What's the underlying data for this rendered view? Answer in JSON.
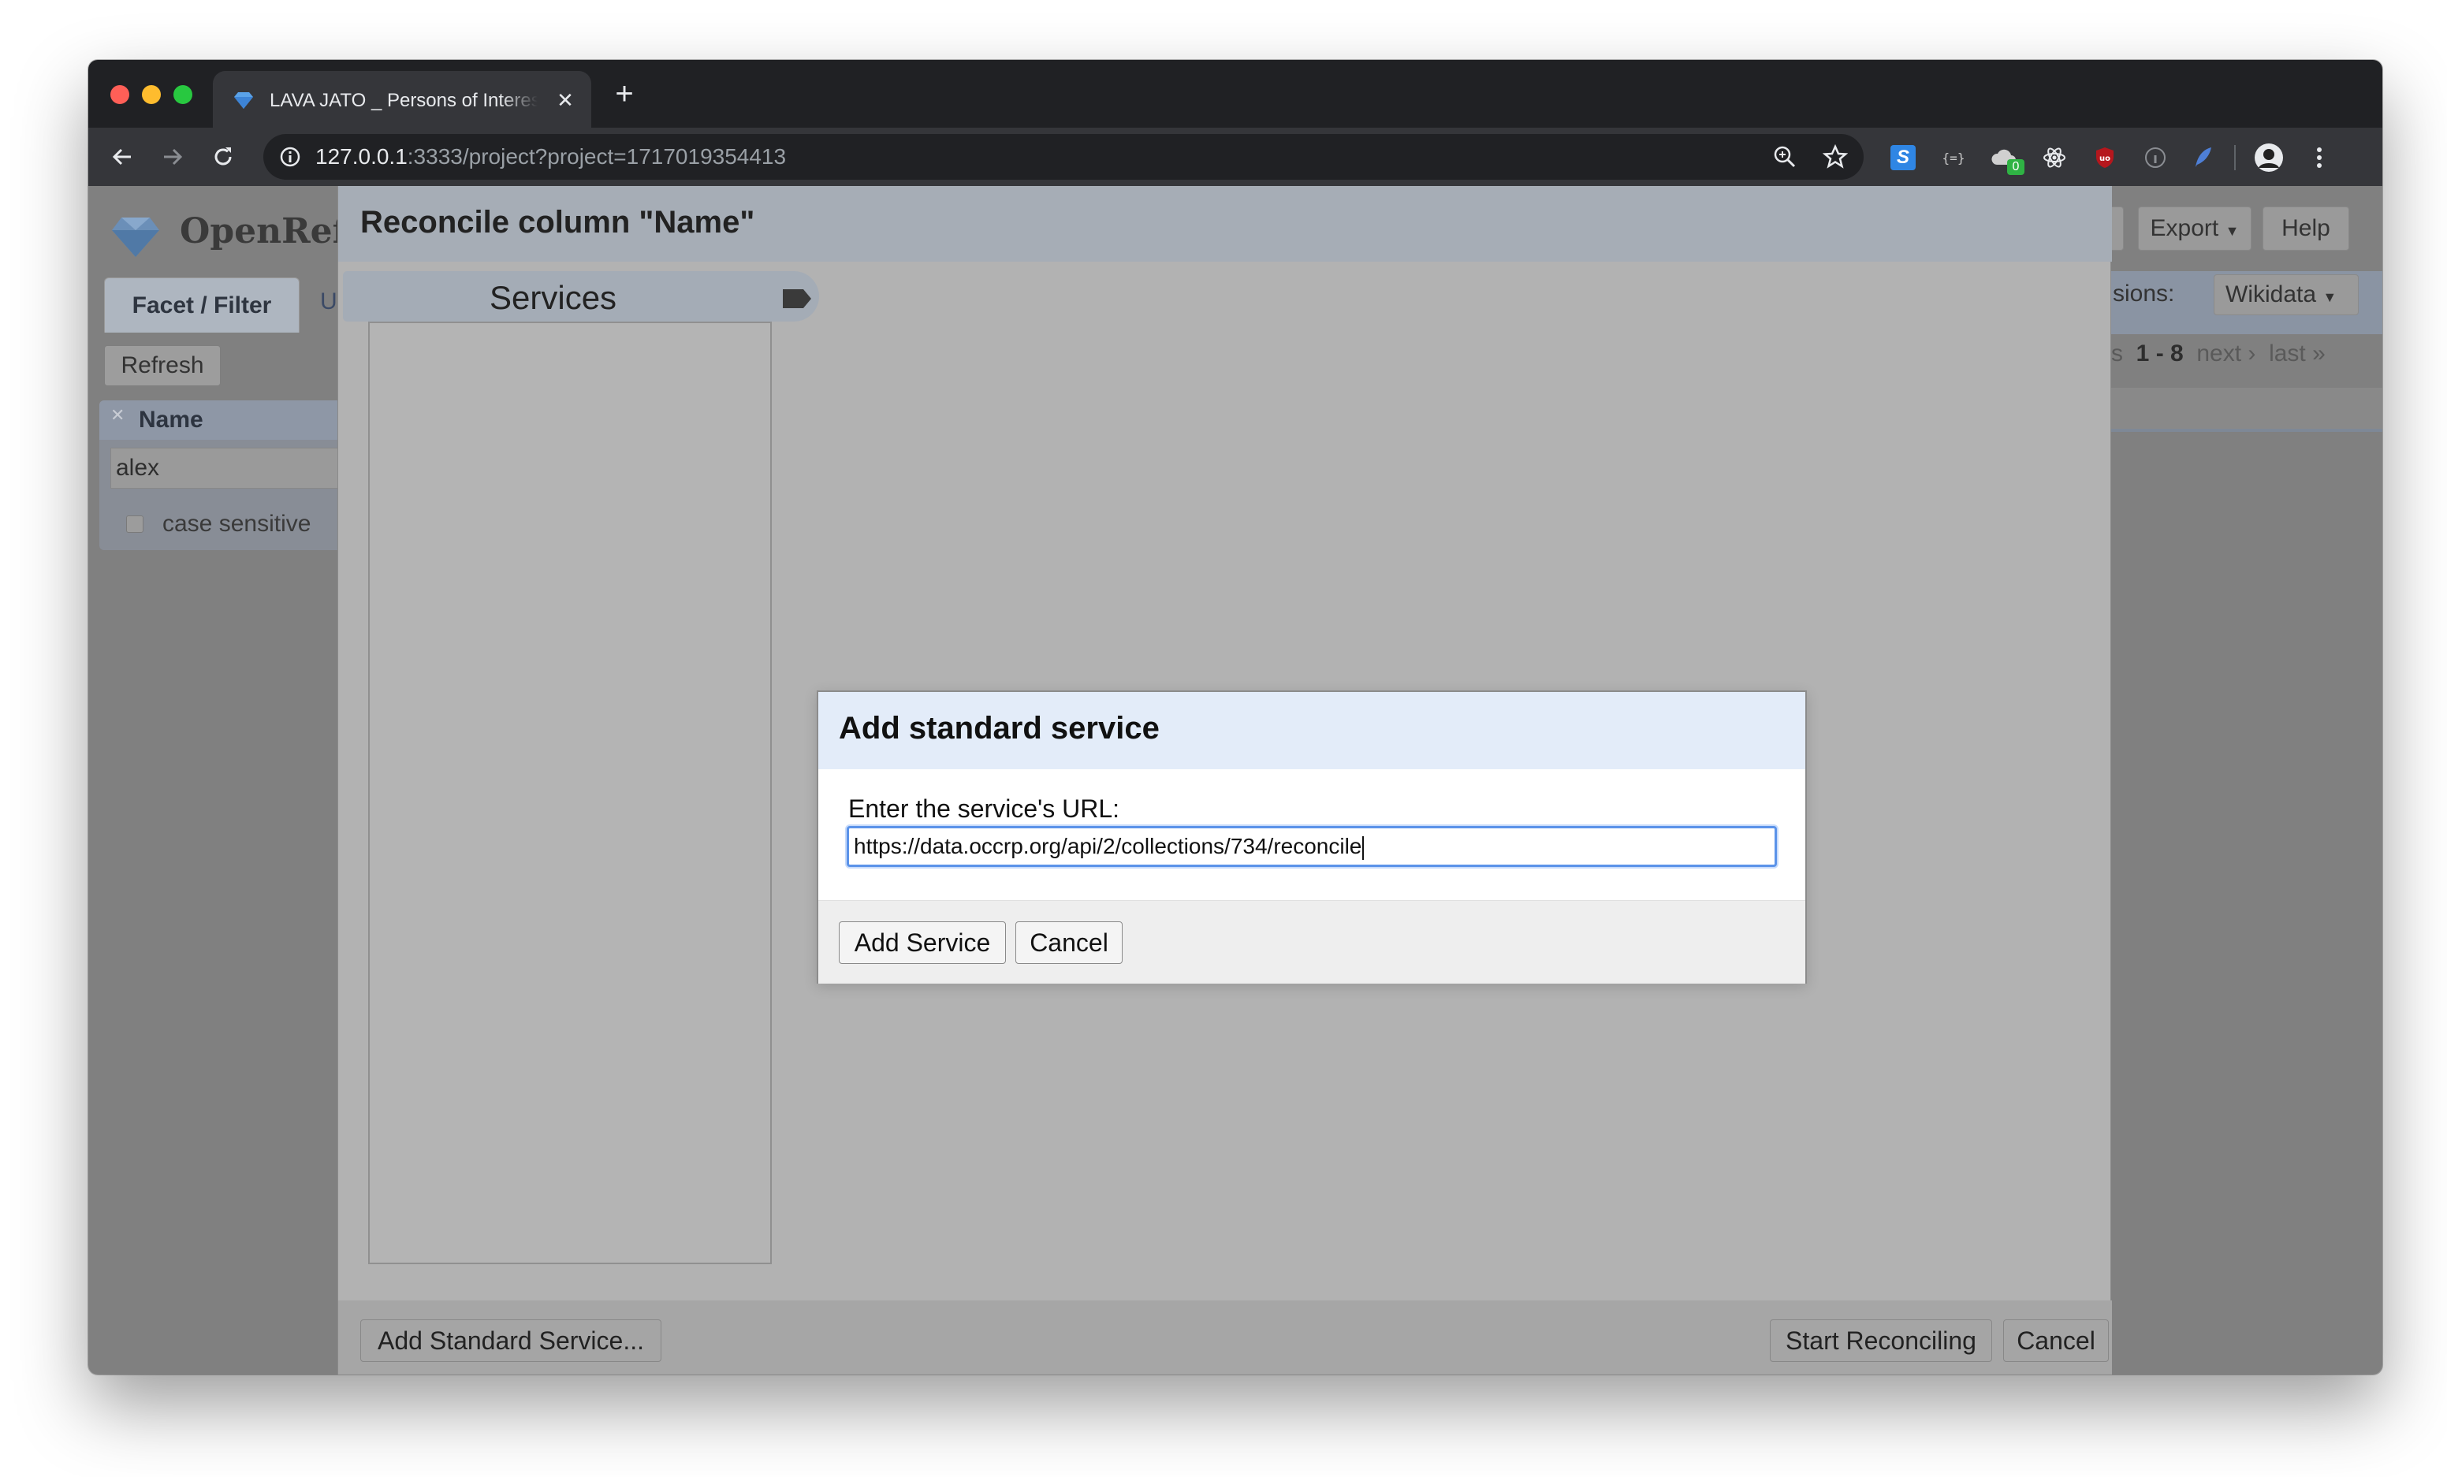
{
  "browser": {
    "tab_title": "LAVA JATO _ Persons of Interest",
    "url_host": "127.0.0.1",
    "url_rest": ":3333/project?project=1717019354413",
    "extension_badge": "0"
  },
  "app": {
    "logo_text": "OpenRefi",
    "left_tabs": [
      "Facet / Filter",
      "U"
    ],
    "refresh_label": "Refresh",
    "facet": {
      "title": "Name",
      "value": "alex",
      "checkbox_label": "case sensitive"
    },
    "export_label": "Export",
    "help_label": "Help",
    "extensions_label": "sions:",
    "wikidata_label": "Wikidata",
    "pager": {
      "prefix": "s",
      "range": "1 - 8",
      "next": "next ›",
      "last": "last »"
    }
  },
  "reconcile": {
    "title": "Reconcile column \"Name\"",
    "services_label": "Services",
    "add_standard_label": "Add Standard Service...",
    "start_label": "Start Reconciling",
    "cancel_label": "Cancel"
  },
  "add_service_dialog": {
    "title": "Add standard service",
    "prompt": "Enter the service's URL:",
    "url_value": "https://data.occrp.org/api/2/collections/734/reconcile",
    "add_label": "Add Service",
    "cancel_label": "Cancel"
  }
}
